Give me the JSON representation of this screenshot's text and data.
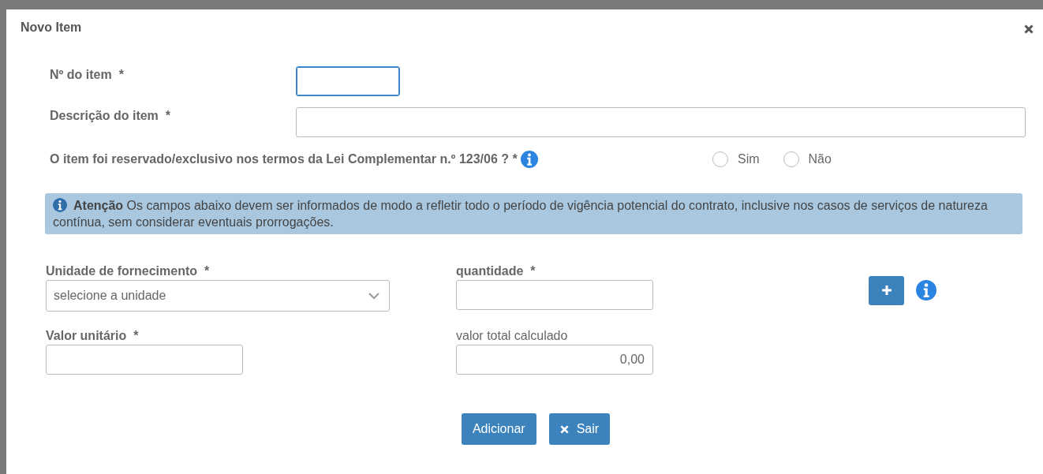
{
  "dialog": {
    "title": "Novo Item"
  },
  "top_fields": [
    {
      "kind": "short",
      "label": "Nº do item  *",
      "focused": true
    },
    {
      "kind": "wide",
      "label": "Descrição do item  *",
      "focused": false
    }
  ],
  "question": {
    "label": "O item foi reservado/exclusivo nos termos da Lei Complementar n.º 123/06 ? *",
    "options": [
      {
        "label": "Sim",
        "selected": false
      },
      {
        "label": "Não",
        "selected": false
      }
    ]
  },
  "alert": {
    "text": "**Atenção** Os campos abaixo devem ser informados de modo a refletir todo o período de vigência potencial do contrato, inclusive nos casos de serviços de natureza contínua, sem considerar eventuais prorrogações."
  },
  "fields": [
    {
      "kind": "select",
      "label": "Unidade de fornecimento  *",
      "placeholder": "selecione a unidade"
    },
    {
      "kind": "input",
      "label": "quantidade  *"
    },
    {
      "kind": "input",
      "label": "Valor unitário  *"
    },
    {
      "kind": "readonly",
      "label": "valor total calculado",
      "value": "0,00"
    }
  ],
  "buttons": [
    {
      "kind": "primary",
      "label": "Adicionar"
    },
    {
      "kind": "close",
      "label": "Sair"
    }
  ]
}
